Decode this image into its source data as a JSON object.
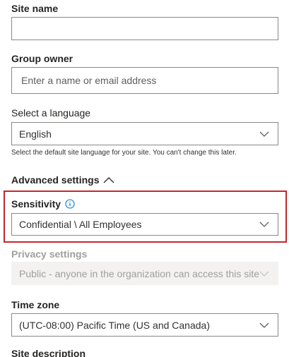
{
  "site_name": {
    "label": "Site name",
    "value": ""
  },
  "group_owner": {
    "label": "Group owner",
    "placeholder": "Enter a name or email address"
  },
  "language": {
    "label": "Select a language",
    "selected": "English",
    "help_text": "Select the default site language for your site. You can't change this later."
  },
  "advanced_settings": {
    "label": "Advanced settings",
    "expanded": true
  },
  "sensitivity": {
    "label": "Sensitivity",
    "selected": "Confidential \\ All Employees",
    "highlight_color": "#c4262e"
  },
  "privacy": {
    "label": "Privacy settings",
    "selected": "Public - anyone in the organization can access this site",
    "disabled": true
  },
  "time_zone": {
    "label": "Time zone",
    "selected": "(UTC-08:00) Pacific Time (US and Canada)"
  },
  "site_description": {
    "label": "Site description"
  },
  "colors": {
    "text": "#252423",
    "border": "#8a8886",
    "disabled_text": "#a19f9d",
    "disabled_bg": "#f3f2f1",
    "info_icon": "#0078d4",
    "highlight": "#c4262e"
  }
}
